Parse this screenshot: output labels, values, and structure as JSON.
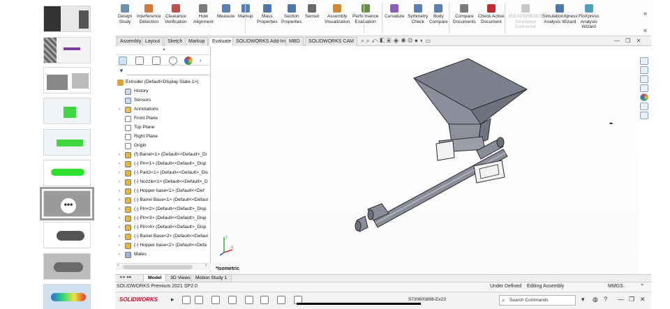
{
  "ribbon": {
    "buttons": [
      {
        "label": "Design\nStudy",
        "icon": "design-study-icon",
        "color": "#6f8fb5"
      },
      {
        "label": "Interference\nDetection",
        "icon": "interference-icon",
        "color": "#d07a3a"
      },
      {
        "label": "Clearance\nVerification",
        "icon": "clearance-icon",
        "color": "#c05050"
      },
      {
        "label": "Hole\nAlignment",
        "icon": "hole-alignment-icon",
        "color": "#7a7a7a"
      },
      {
        "label": "Measure",
        "icon": "measure-icon",
        "color": "#5a7fb0"
      },
      {
        "label": "Markup",
        "icon": "markup-icon",
        "color": "#5a7fb0"
      },
      {
        "label": "Mass\nProperties",
        "icon": "mass-properties-icon",
        "color": "#4f76a8"
      },
      {
        "label": "Section\nProperties",
        "icon": "section-properties-icon",
        "color": "#4f76a8"
      },
      {
        "label": "Sensor",
        "icon": "sensor-icon",
        "color": "#6a6a6a"
      },
      {
        "label": "Assembly\nVisualization",
        "icon": "assembly-visualization-icon",
        "color": "#d08a30"
      },
      {
        "label": "Performance\nEvaluation",
        "icon": "performance-icon",
        "color": "#6a8f4a"
      },
      {
        "label": "Curvature",
        "icon": "curvature-icon",
        "color": "#8a5fb5"
      },
      {
        "label": "Symmetry\nCheck",
        "icon": "symmetry-icon",
        "color": "#5a7fb0"
      },
      {
        "label": "Body\nCompare",
        "icon": "body-compare-icon",
        "color": "#5a7fb0"
      },
      {
        "label": "Compare\nDocuments",
        "icon": "compare-documents-icon",
        "color": "#7a7a7a"
      },
      {
        "label": "Check Active\nDocument",
        "icon": "check-active-icon",
        "color": "#c03030"
      },
      {
        "label": "3DEXPERIENCE\nSimulation\nConnector",
        "icon": "3dx-icon",
        "color": "#c8c8c8",
        "disabled": true
      },
      {
        "label": "SimulationXpress\nAnalysis Wizard",
        "icon": "simxpress-icon",
        "color": "#4f76a8"
      },
      {
        "label": "FloXpress\nAnalysis\nWizard",
        "icon": "floxpress-icon",
        "color": "#4f9fc0"
      }
    ]
  },
  "tabs": [
    "Assembly",
    "Layout",
    "Sketch",
    "Markup",
    "Evaluate",
    "SOLIDWORKS Add-Ins",
    "MBD",
    "SOLIDWORKS CAM"
  ],
  "active_tab": "Evaluate",
  "tree": {
    "root": "Extruder  (Default<Display State-1>)",
    "items": [
      {
        "label": "History",
        "icon": "history-icon",
        "indent": 1,
        "expand": ""
      },
      {
        "label": "Sensors",
        "icon": "sensors-icon",
        "indent": 1,
        "expand": ""
      },
      {
        "label": "Annotations",
        "icon": "annotations-icon",
        "indent": 1,
        "expand": "›"
      },
      {
        "label": "Front Plane",
        "icon": "plane-icon",
        "indent": 1,
        "expand": ""
      },
      {
        "label": "Top Plane",
        "icon": "plane-icon",
        "indent": 1,
        "expand": ""
      },
      {
        "label": "Right Plane",
        "icon": "plane-icon",
        "indent": 1,
        "expand": ""
      },
      {
        "label": "Origin",
        "icon": "origin-icon",
        "indent": 1,
        "expand": ""
      },
      {
        "label": "(f) Barrel<1> (Default<<Default>_Di",
        "icon": "part-icon",
        "indent": 1,
        "expand": "›"
      },
      {
        "label": "(-) Pin<1> (Default<<Default>_Disp",
        "icon": "part-icon",
        "indent": 1,
        "expand": "›"
      },
      {
        "label": "(-) Part2<1> (Default<<Default>_Dis",
        "icon": "part-icon",
        "indent": 1,
        "expand": "›"
      },
      {
        "label": "(-) Nozzle<1> (Default<<Default>_D",
        "icon": "part-icon",
        "indent": 1,
        "expand": "›"
      },
      {
        "label": "(-) Hopper base<1> (Default<<Def",
        "icon": "part-icon",
        "indent": 1,
        "expand": "›"
      },
      {
        "label": "(-) Barrel Base<1> (Default<<Defaul",
        "icon": "part-icon",
        "indent": 1,
        "expand": "›"
      },
      {
        "label": "(-) Pin<2> (Default<<Default>_Disp",
        "icon": "part-icon",
        "indent": 1,
        "expand": "›"
      },
      {
        "label": "(-) Pin<3> (Default<<Default>_Disp",
        "icon": "part-icon",
        "indent": 1,
        "expand": "›"
      },
      {
        "label": "(-) Pin<4> (Default<<Default>_Disp",
        "icon": "part-icon",
        "indent": 1,
        "expand": "›"
      },
      {
        "label": "(-) Barrel Base<2> (Default<<Defaul",
        "icon": "part-icon",
        "indent": 1,
        "expand": "›"
      },
      {
        "label": "(-) Hopper base<2> (Default<<Defa",
        "icon": "part-icon",
        "indent": 1,
        "expand": "›"
      },
      {
        "label": "Mates",
        "icon": "mates-icon",
        "indent": 1,
        "expand": "›"
      }
    ]
  },
  "viewport": {
    "view_name": "*Isometric"
  },
  "bottom_tabs": [
    "Model",
    "3D Views",
    "Motion Study 1"
  ],
  "active_bottom_tab": "Model",
  "status": {
    "app": "SOLIDWORKS Premium 2021 SP2.0",
    "state": "Under Defined",
    "mode": "Editing Assembly",
    "units": "MMGS"
  },
  "taskbar": {
    "logo": "SOLIDWORKS",
    "doc_title": "S730600898-Ex23",
    "search_placeholder": "Search Commands"
  },
  "colors": {
    "hopper": "#7c7e8c",
    "barrel": "#8a8c9a",
    "accent": "#2b5d99"
  }
}
